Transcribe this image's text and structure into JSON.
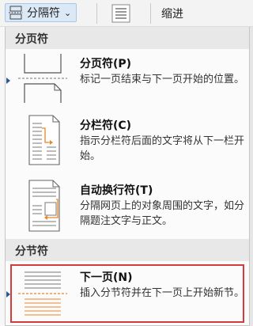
{
  "ribbon": {
    "breaks_label": "分隔符",
    "indent_label": "缩进"
  },
  "menu": {
    "section_page": "分页符",
    "section_section": "分节符",
    "items": [
      {
        "title": "分页符(P)",
        "desc": "标记一页结束与下一页开始的位置。"
      },
      {
        "title": "分栏符(C)",
        "desc": "指示分栏符后面的文字将从下一栏开始。"
      },
      {
        "title": "自动换行符(T)",
        "desc": "分隔网页上的对象周围的文字，如分隔题注文字与正文。"
      },
      {
        "title": "下一页(N)",
        "desc": "插入分节符并在下一页上开始新节。"
      }
    ]
  },
  "colors": {
    "accent_orange": "#e8862a",
    "marker_blue": "#2b5797",
    "highlight_red": "#d23c3c"
  }
}
